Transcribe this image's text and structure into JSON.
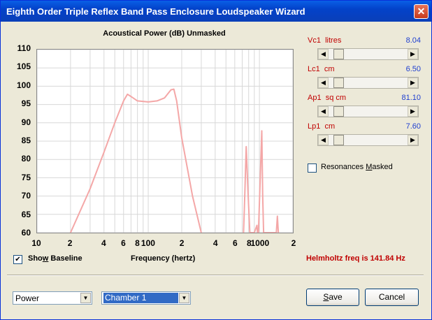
{
  "window": {
    "title": "Eighth Order Triple Reflex Band Pass Enclosure Loudspeaker Wizard",
    "close": "✕"
  },
  "chart": {
    "title": "Acoustical Power (dB)   Unmasked",
    "xlabel": "Frequency (hertz)"
  },
  "chart_data": {
    "type": "line",
    "title": "Acoustical Power (dB)   Unmasked",
    "xlabel": "Frequency (hertz)",
    "ylabel": "",
    "x_scale": "log",
    "xlim": [
      10,
      2000
    ],
    "ylim": [
      60,
      110
    ],
    "y_ticks": [
      "110",
      "105",
      "100",
      "95",
      "90",
      "85",
      "80",
      "75",
      "70",
      "65",
      "60"
    ],
    "x_ticks": [
      "10",
      "2",
      "4",
      "6",
      "8",
      "100",
      "2",
      "4",
      "6",
      "8",
      "1000",
      "2"
    ],
    "grid": true,
    "series": [
      {
        "color": "#f4a7a7",
        "x": [
          20,
          30,
          40,
          50,
          60,
          65,
          70,
          80,
          100,
          120,
          140,
          160,
          170,
          180,
          200,
          250,
          300
        ],
        "y": [
          60,
          72,
          82,
          90,
          96,
          97.8,
          97.2,
          96,
          95.7,
          96,
          96.8,
          99,
          99.2,
          96,
          86,
          70,
          60
        ]
      },
      {
        "color": "#f4a7a7",
        "x": [
          720,
          740,
          760,
          790,
          820,
          900,
          950,
          960,
          980,
          1050,
          1070,
          1090,
          1130,
          1420,
          1450,
          1480
        ],
        "y": [
          60,
          71,
          83.5,
          71,
          60,
          60,
          62,
          60,
          60,
          87.8,
          70,
          60,
          60,
          60,
          64.5,
          60
        ]
      }
    ]
  },
  "sliders": [
    {
      "label": "Vc1",
      "unit": "litres",
      "value": "8.04"
    },
    {
      "label": "Lc1",
      "unit": "cm",
      "value": "6.50"
    },
    {
      "label": "Ap1",
      "unit": "sq cm",
      "value": "81.10"
    },
    {
      "label": "Lp1",
      "unit": "cm",
      "value": "7.60"
    }
  ],
  "resonances": {
    "label_pre": "Resonances ",
    "label_key": "M",
    "label_post": "asked",
    "checked": false
  },
  "baseline": {
    "label_pre": "Sho",
    "label_key": "w",
    "label_post": " Baseline",
    "checked": true,
    "mark": "✔"
  },
  "helmholtz": "Helmholtz freq is 141.84 Hz",
  "combos": {
    "view": "Power",
    "chamber": "Chamber 1",
    "arrow": "▼"
  },
  "buttons": {
    "save_key": "S",
    "save_rest": "ave",
    "cancel": "Cancel"
  },
  "scroll_arrows": {
    "left": "◀",
    "right": "▶"
  },
  "colors": {
    "curve": "#f4a7a7",
    "value_text": "#2040d0",
    "label_text": "#c00000",
    "titlebar": "#0342c9"
  }
}
